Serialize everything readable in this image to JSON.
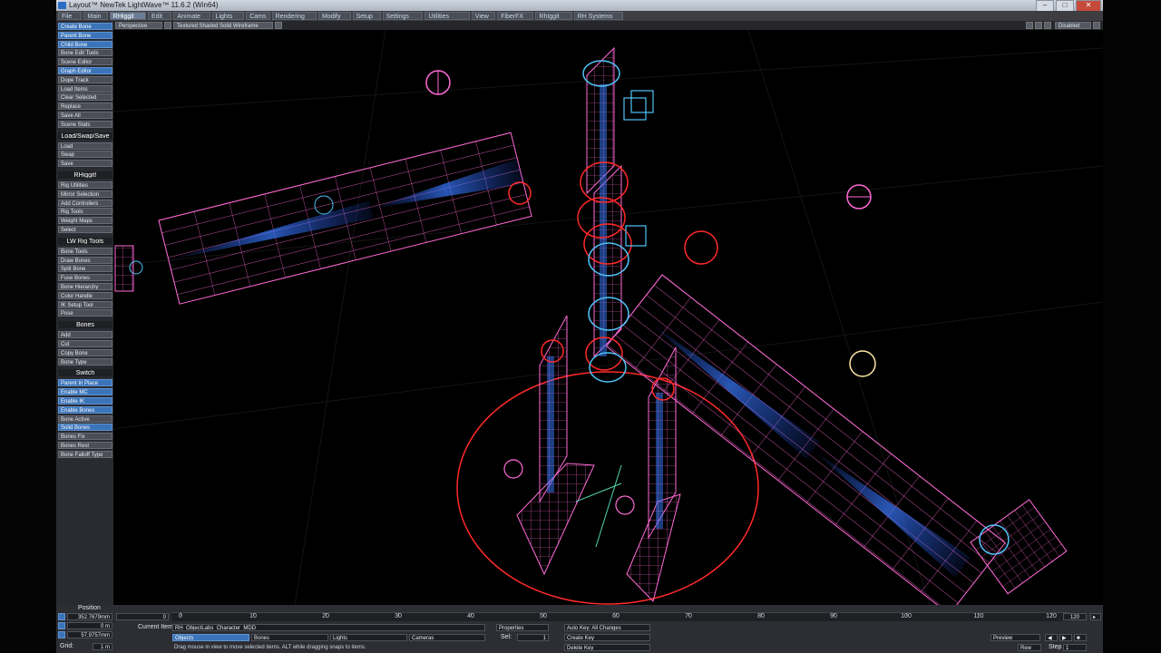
{
  "title_bar": {
    "title": "Layout™ NewTek LightWave™ 11.6.2 (Win64)",
    "buttons": [
      "–",
      "□",
      "✕"
    ]
  },
  "menu_tabs": [
    "File",
    "Main",
    "RHiggit",
    "Edit",
    "Animate",
    "Lights",
    "Cams",
    "Rendering",
    "Modify",
    "Setup",
    "Settings",
    "Utilities",
    "View",
    "FiberFX",
    "RhIggit",
    "RH Systems"
  ],
  "active_tab_index": 2,
  "view_bar": {
    "view_mode": "Perspective",
    "shading": "Textured Shaded Solid Wireframe",
    "right_label": "Disabled"
  },
  "toolbar": {
    "items": [
      {
        "label": "Create Bone",
        "style": "blue"
      },
      {
        "label": "Parent Bone",
        "style": "blue"
      },
      {
        "label": "Child Bone",
        "style": "blue"
      },
      {
        "label": "Bone Edit Tools",
        "style": "plain"
      },
      {
        "label": "Scene Editor",
        "style": "plain"
      },
      {
        "label": "Graph Editor",
        "style": "blue"
      },
      {
        "label": "Dope Track",
        "style": "plain"
      },
      {
        "label": "Load Items",
        "style": "plain"
      },
      {
        "label": "Clear Selected",
        "style": "plain"
      },
      {
        "label": "Replace",
        "style": "plain"
      },
      {
        "label": "Save All",
        "style": "plain"
      },
      {
        "label": "Scene Stats",
        "style": "plain"
      },
      {
        "label": "Load/Swap/Save",
        "style": "head"
      },
      {
        "label": "Load",
        "style": "plain"
      },
      {
        "label": "Swap",
        "style": "plain"
      },
      {
        "label": "Save",
        "style": "plain"
      },
      {
        "label": "RHiggit!",
        "style": "head"
      },
      {
        "label": "Rig Utilities",
        "style": "plain"
      },
      {
        "label": "Mirror Selection",
        "style": "plain"
      },
      {
        "label": "Add Controllers",
        "style": "plain"
      },
      {
        "label": "Rig Tools",
        "style": "plain"
      },
      {
        "label": "Weight Maps",
        "style": "plain"
      },
      {
        "label": "Select",
        "style": "plain"
      },
      {
        "label": "LW Rig Tools",
        "style": "head"
      },
      {
        "label": "Bone Tools",
        "style": "plain"
      },
      {
        "label": "Draw Bones",
        "style": "plain"
      },
      {
        "label": "Split Bone",
        "style": "plain"
      },
      {
        "label": "Fuse Bones",
        "style": "plain"
      },
      {
        "label": "Bone Hierarchy",
        "style": "plain"
      },
      {
        "label": "Color Handle",
        "style": "plain"
      },
      {
        "label": "IK Setup Tool",
        "style": "plain"
      },
      {
        "label": "Pose",
        "style": "plain"
      },
      {
        "label": "Bones",
        "style": "head"
      },
      {
        "label": "Add",
        "style": "plain"
      },
      {
        "label": "Cut",
        "style": "plain"
      },
      {
        "label": "Copy Bone",
        "style": "plain"
      },
      {
        "label": "Bone Type",
        "style": "plain"
      },
      {
        "label": "Switch",
        "style": "head"
      },
      {
        "label": "Parent In Place",
        "style": "blue"
      },
      {
        "label": "Enable MC",
        "style": "blue"
      },
      {
        "label": "Enable IK",
        "style": "blue"
      },
      {
        "label": "Enable Bones",
        "style": "blue"
      },
      {
        "label": "Bone Active",
        "style": "plain"
      },
      {
        "label": "Solid Bones",
        "style": "blue"
      },
      {
        "label": "Bones Fix",
        "style": "plain"
      },
      {
        "label": "Bones Rest",
        "style": "plain"
      },
      {
        "label": "Bone Falloff Type",
        "style": "plain"
      }
    ]
  },
  "timeline": {
    "position_label": "Position",
    "x_value": "352.7679mm",
    "y_value": "0 m",
    "z_value": "57.9757mm",
    "grid_label": "Grid:",
    "grid_value": "1 m",
    "ruler_ticks": [
      "0",
      "10",
      "20",
      "30",
      "40",
      "50",
      "60",
      "70",
      "80",
      "90",
      "100",
      "110",
      "120"
    ],
    "end_frame": "120",
    "current_item_label": "Current Item",
    "current_item_value": "RH_ObjectLabs_Character_MDD",
    "objects_btn": "Objects",
    "bones_btn": "Bones",
    "lights_btn": "Lights",
    "cameras_btn": "Cameras",
    "properties_btn": "Properties",
    "sel_label": "Sel:",
    "sel_value": "1",
    "auto_key_label": "Auto Key: All Changes",
    "create_key": "Create Key",
    "delete_key": "Delete Key",
    "preview_label": "Preview",
    "rewind_label": "Rew",
    "step_label": "Step",
    "step_value": "1",
    "status_hint": "Drag mouse in view to move selected items. ALT while dragging snaps to items."
  },
  "colors": {
    "viewport_bg": "#000000",
    "bone_pink": "#ff5fd0",
    "null_cyan": "#4fc3f7",
    "ik_red": "#ff2a2a",
    "accent_blue": "#3b74b8"
  }
}
